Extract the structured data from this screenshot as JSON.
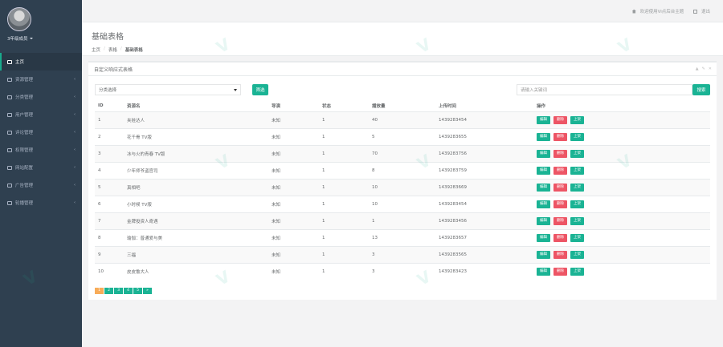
{
  "sidebar": {
    "username": "3年级成员",
    "items": [
      {
        "label": "主页",
        "active": true
      },
      {
        "label": "资源管理"
      },
      {
        "label": "分类管理"
      },
      {
        "label": "用户管理"
      },
      {
        "label": "评论管理"
      },
      {
        "label": "权限管理"
      },
      {
        "label": "网站配置"
      },
      {
        "label": "广告管理"
      },
      {
        "label": "轮播管理"
      }
    ]
  },
  "topbar": {
    "welcome": "欢迎使用Vi点后台主题",
    "logout": "退出"
  },
  "heading": {
    "title": "基础表格",
    "breadcrumb": [
      "主页",
      "表格",
      "基础表格"
    ]
  },
  "panel": {
    "title": "自定义响应式表格",
    "category_select": "分类选择",
    "filter_button": "筛选",
    "search_placeholder": "请输入关键词",
    "search_button": "搜索"
  },
  "table": {
    "headers": [
      "ID",
      "资源名",
      "导演",
      "状态",
      "播放量",
      "上传时间",
      "操作"
    ],
    "action_labels": {
      "edit": "编辑",
      "delete": "删除",
      "up": "上架"
    },
    "rows": [
      {
        "id": "1",
        "name": "夹娃达人",
        "dept": "未知",
        "state": "1",
        "plays": "40",
        "time": "1439283454"
      },
      {
        "id": "2",
        "name": "花千骨 TV版",
        "dept": "未知",
        "state": "1",
        "plays": "5",
        "time": "1439283655"
      },
      {
        "id": "3",
        "name": "冰与火的青春 TV版",
        "dept": "未知",
        "state": "1",
        "plays": "70",
        "time": "1439283756"
      },
      {
        "id": "4",
        "name": "少年师爷盗官司",
        "dept": "未知",
        "state": "1",
        "plays": "8",
        "time": "1439283759"
      },
      {
        "id": "5",
        "name": "真相吧",
        "dept": "未知",
        "state": "1",
        "plays": "10",
        "time": "1439283669"
      },
      {
        "id": "6",
        "name": "小时候 TV版",
        "dept": "未知",
        "state": "1",
        "plays": "10",
        "time": "1439283454"
      },
      {
        "id": "7",
        "name": "金牌投资人奇遇",
        "dept": "未知",
        "state": "1",
        "plays": "1",
        "time": "1439283456"
      },
      {
        "id": "8",
        "name": "瑜伽：普通爱与美",
        "dept": "未知",
        "state": "1",
        "plays": "13",
        "time": "1439283657"
      },
      {
        "id": "9",
        "name": "三福",
        "dept": "未知",
        "state": "1",
        "plays": "3",
        "time": "1439283565"
      },
      {
        "id": "10",
        "name": "皮皮鲁大人",
        "dept": "未知",
        "state": "1",
        "plays": "3",
        "time": "1439283423"
      }
    ]
  },
  "pagination": [
    "1",
    "2",
    "3",
    "4",
    "5",
    "»"
  ],
  "colors": {
    "sidebar": "#2f4050",
    "accent": "#1ab394",
    "danger": "#ed5565",
    "current_page": "#f8ac59"
  }
}
